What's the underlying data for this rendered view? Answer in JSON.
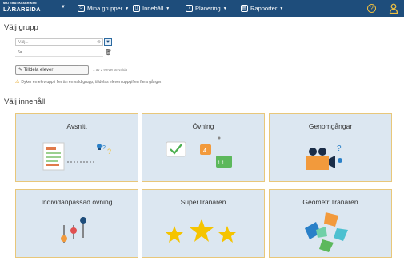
{
  "header": {
    "brand_small": "MATEMATIKFABRIKEN",
    "brand_title": "LÄRARSIDA",
    "nav": [
      {
        "label": "Mina grupper",
        "icon": "people-icon"
      },
      {
        "label": "Innehåll",
        "icon": "book-icon"
      },
      {
        "label": "Planering",
        "icon": "question-icon"
      },
      {
        "label": "Rapporter",
        "icon": "chart-icon"
      }
    ],
    "help_icon": "?"
  },
  "group_section": {
    "title": "Välj grupp",
    "select_placeholder": "Välj...",
    "selected_item": "6a",
    "assign_button": "Tilldela elever",
    "assign_count": "1 av 2 elever är valda",
    "warning": "Dyker en elev upp i fler än en vald grupp, tilldelas eleven uppgiften flera gånger."
  },
  "content_section": {
    "title": "Välj innehåll",
    "cards": [
      {
        "label": "Avsnitt",
        "icon": "document-icon"
      },
      {
        "label": "Övning",
        "icon": "chat-icon"
      },
      {
        "label": "Genomgångar",
        "icon": "camera-icon"
      },
      {
        "label": "Individanpassad övning",
        "icon": "sliders-icon"
      },
      {
        "label": "SuperTränaren",
        "icon": "stars-icon"
      },
      {
        "label": "GeometriTränaren",
        "icon": "puzzle-icon"
      }
    ]
  },
  "colors": {
    "nav_bg": "#1e4d7b",
    "card_bg": "#dce7f1",
    "card_border": "#e8c77a",
    "accent_yellow": "#f5c400"
  }
}
